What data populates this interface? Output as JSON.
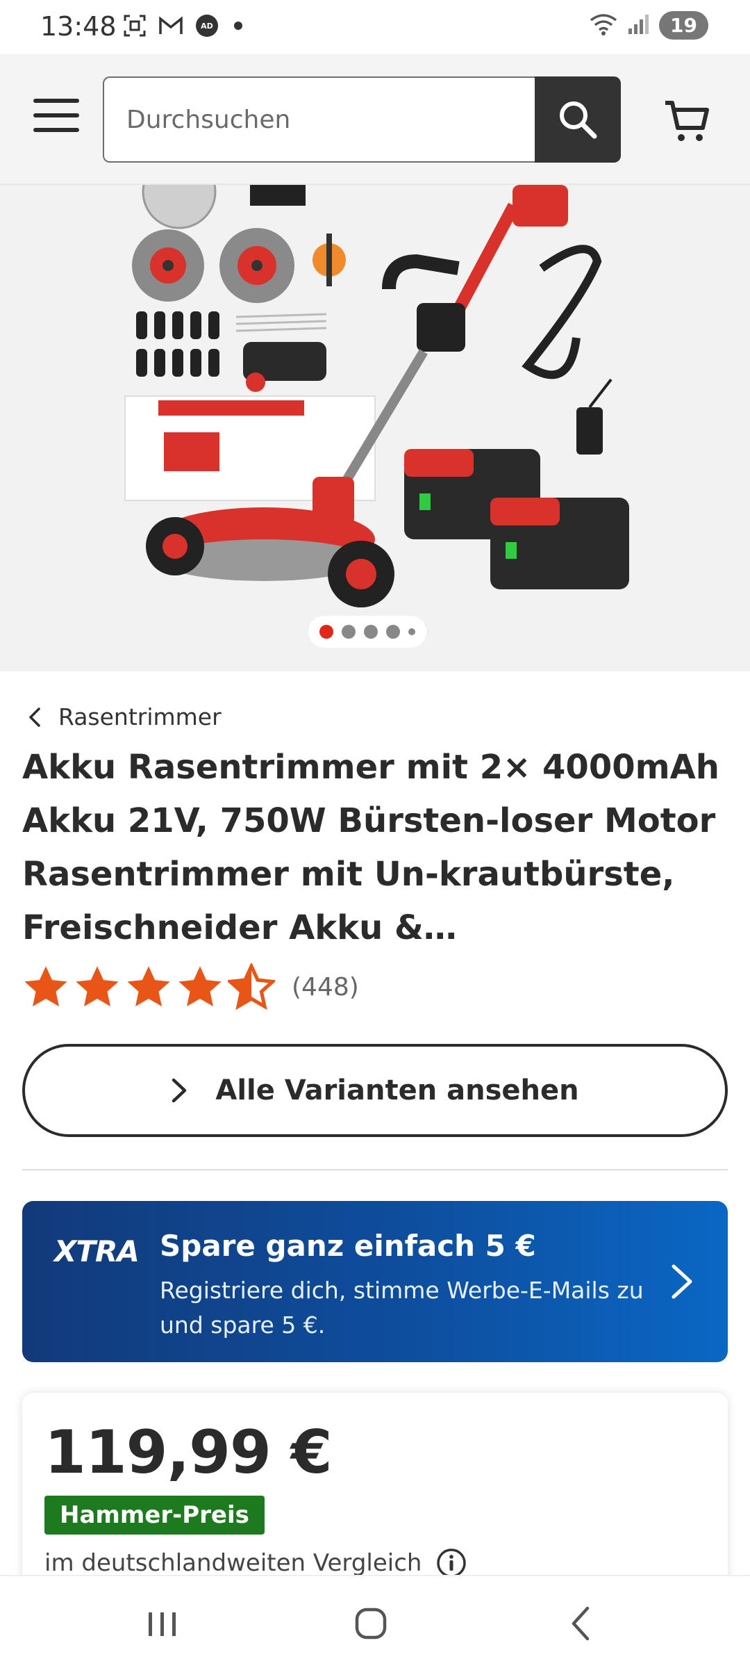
{
  "status_bar": {
    "time": "13:48",
    "battery": "19",
    "left_icons": [
      "screenshot-icon",
      "gmail-icon",
      "adblocker-icon"
    ],
    "right_icons": [
      "wifi-icon",
      "signal-icon"
    ]
  },
  "header": {
    "search_placeholder": "Durchsuchen",
    "icons": [
      "menu-icon",
      "search-icon",
      "cart-icon"
    ]
  },
  "gallery": {
    "image_count": 5,
    "active_index": 0
  },
  "breadcrumb": {
    "label": "Rasentrimmer"
  },
  "product": {
    "title": "Akku Rasentrimmer mit 2× 4000mAh Akku 21V, 750W Bürsten-loser Motor Rasentrimmer mit Un-krautbürste, Freischneider Akku &…",
    "rating": 4.5,
    "rating_max": 5,
    "rating_count": "(448)"
  },
  "variants_button": {
    "label": "Alle Varianten ansehen"
  },
  "xtra_banner": {
    "logo": "XTRA",
    "title": "Spare ganz einfach 5 €",
    "text": "Registriere dich, stimme Werbe-E-Mails zu und spare 5 €."
  },
  "price_card": {
    "price": "119,99 €",
    "badge": "Hammer-Preis",
    "compare_text": "im deutschlandweiten Vergleich"
  },
  "colors": {
    "accent_red": "#e1261c",
    "star_orange": "#e95516",
    "badge_green": "#1e7a1e",
    "xtra_blue": "#0e4e9e",
    "text_dark": "#2b2b2b"
  }
}
